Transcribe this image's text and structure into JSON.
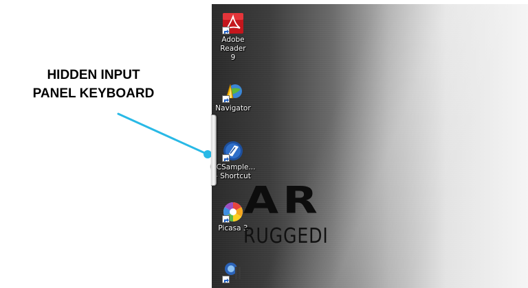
{
  "callout": {
    "line1": "HIDDEN INPUT",
    "line2": "PANEL KEYBOARD",
    "leader_color": "#29b9e6"
  },
  "desktop": {
    "icons": [
      {
        "label_line1": "Adobe Reader",
        "label_line2": "9",
        "icon": "adobe-reader-icon"
      },
      {
        "label_line1": "Navigator",
        "label_line2": "",
        "icon": "navigator-icon"
      },
      {
        "label_line1": "QCSample...",
        "label_line2": "- Shortcut",
        "icon": "qcsample-icon"
      },
      {
        "label_line1": "Picasa 3",
        "label_line2": "",
        "icon": "picasa-icon"
      },
      {
        "label_line1": "",
        "label_line2": "",
        "icon": "blue-app-icon"
      }
    ],
    "brand": {
      "title": "AR",
      "subtitle": "RUGGEDI"
    }
  }
}
